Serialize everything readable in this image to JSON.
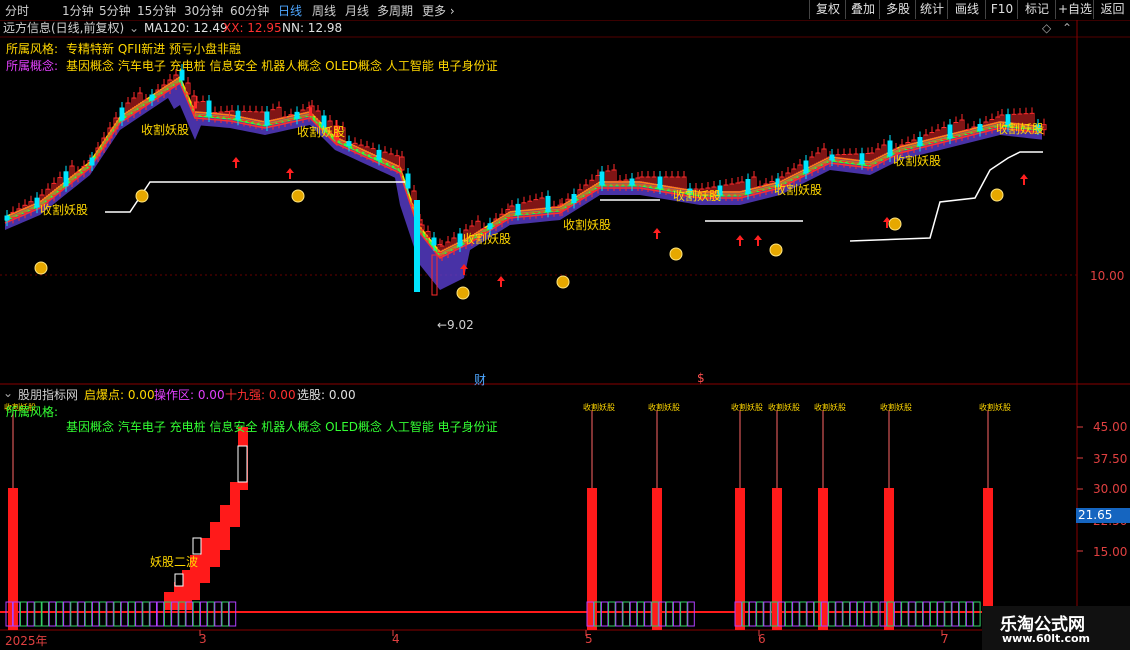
{
  "toolbar": {
    "periods": [
      "分时",
      "1分钟",
      "5分钟",
      "15分钟",
      "30分钟",
      "60分钟",
      "日线",
      "周线",
      "月线",
      "多周期",
      "更多"
    ],
    "active": "日线",
    "right_buttons": [
      "复权",
      "叠加",
      "多股",
      "统计",
      "画线",
      "F10",
      "+自选",
      "返回"
    ]
  },
  "main_header": {
    "stock": "远方信息(日线,前复权)",
    "ma_label": "MA120: 12.49",
    "xx_label": "XX: 12.95",
    "nn_label": "NN: 12.98"
  },
  "info": {
    "style_label": "所属风格:",
    "style_value": "专精特新 QFII新进 预亏小盘非融",
    "concept_label": "所属概念:",
    "concept_value": "基因概念 汽车电子 充电桩 信息安全 机器人概念 OLED概念 人工智能 电子身份证"
  },
  "annotations": {
    "harvest": "收割妖股",
    "low_price": "←9.02",
    "cai": "财",
    "s_mark": "$"
  },
  "price_axis": {
    "label": "10.00"
  },
  "indicator_header": {
    "name": "股朋指标网",
    "qbd": "启爆点: 0.00",
    "czq": "操作区: 0.00",
    "sjq": "十九强: 0.00",
    "xg": "选股: 0.00"
  },
  "indicator": {
    "style_label": "所属风格:",
    "concept_value": "基因概念 汽车电子 充电桩 信息安全 机器人概念 OLED概念 人工智能 电子身份证",
    "yao_label": "妖股二波",
    "small_harvest": "收割妖股"
  },
  "indicator_axis": {
    "ticks": [
      "45.00",
      "37.50",
      "30.00",
      "22.50",
      "15.00"
    ],
    "current": "21.65"
  },
  "date_axis": {
    "labels": [
      "2025年",
      "3",
      "4",
      "5",
      "6",
      "7"
    ]
  },
  "watermark": {
    "title": "乐淘公式网",
    "url": "www.60lt.com"
  },
  "colors": {
    "up": "#ff2a2a",
    "down": "#00e5ff",
    "yellow": "#ffd700",
    "magenta": "#e040fb",
    "purple": "#7a5cff",
    "green": "#33ff33",
    "active_tab": "#4da6ff"
  }
}
